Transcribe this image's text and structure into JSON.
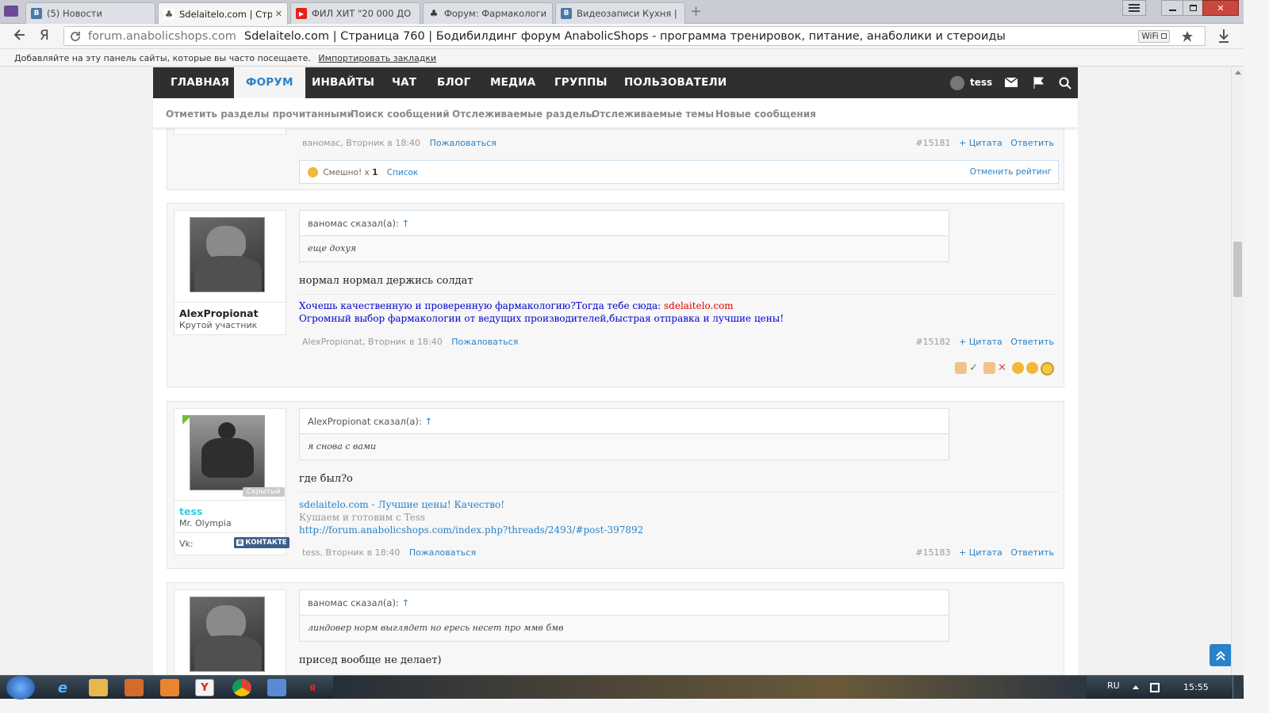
{
  "browser": {
    "tabs": [
      {
        "label": "(5) Новости",
        "icon": "vk-icon",
        "color": "#4a76a8",
        "glyph": "В"
      },
      {
        "label": "Sdelaitelo.com | Стран",
        "icon": "forum-favicon-icon",
        "color": "#555555",
        "glyph": "♣"
      },
      {
        "label": "ФИЛ ХИТ \"20 000 ДО",
        "icon": "youtube-icon",
        "color": "#e62117",
        "glyph": "▶"
      },
      {
        "label": "Форум: Фармакологи",
        "icon": "forum-favicon-icon",
        "color": "#555555",
        "glyph": "♣"
      },
      {
        "label": "Видеозаписи Кухня |",
        "icon": "vk-icon",
        "color": "#4a76a8",
        "glyph": "В"
      }
    ],
    "close_glyph": "✕",
    "new_tab_glyph": "+",
    "yandex_glyph": "Я",
    "url_domain": "forum.anabolicshops.com",
    "url_title": "Sdelaitelo.com | Страница 760 | Бодибилдинг форум AnabolicShops - программа тренировок, питание, анаболики и стероиды",
    "wifi_badge": "WiFi",
    "bookmarks_text": "Добавляйте на эту панель сайты, которые вы часто посещаете.",
    "bookmarks_link": "Импортировать закладки"
  },
  "nav": {
    "items": [
      "ГЛАВНАЯ",
      "ФОРУМ",
      "ИНВАЙТЫ",
      "ЧАТ",
      "БЛОГ",
      "МЕДИА",
      "ГРУППЫ",
      "ПОЛЬЗОВАТЕЛИ"
    ],
    "active": "ФОРУМ",
    "user": "tess"
  },
  "subnav": [
    "Отметить разделы прочитанными",
    "Поиск сообщений",
    "Отслеживаемые разделы",
    "Отслеживаемые темы",
    "Новые сообщения"
  ],
  "post0": {
    "meta": "ваномас, Вторник в 18:40",
    "report": "Пожаловаться",
    "number": "#15181",
    "quote_btn": "+ Цитата",
    "reply_btn": "Ответить",
    "rating_label": "Смешно! x",
    "rating_count": "1",
    "rating_list": "Список",
    "rating_cancel": "Отменить рейтинг"
  },
  "post1": {
    "user": "AlexPropionat",
    "title": "Крутой участник",
    "quote_author": "ваномас сказал(а):",
    "quote_arrow": "↑",
    "quote_text": "еще дохуя",
    "message": "нормал нормал держись солдат",
    "sig_line1": "Хочешь качественную и проверенную фармакологию?Тогда тебе сюда:",
    "sig_link": "sdelaitelo.com",
    "sig_line2": "Огромный выбор фармакологии от ведущих производителей,быстрая отправка и лучшие цены!",
    "meta": "AlexPropionat, Вторник в 18:40",
    "report": "Пожаловаться",
    "number": "#15182",
    "quote_btn": "+ Цитата",
    "reply_btn": "Ответить"
  },
  "post2": {
    "user": "tess",
    "title": "Mr. Olympia",
    "hidden_badge": "Скрытый",
    "vk_label": "Vk:",
    "vk_button": "КОНТАКТЕ",
    "quote_author": "AlexPropionat сказал(а):",
    "quote_arrow": "↑",
    "quote_text": "я снова с вами",
    "message": "где был?о",
    "sig_line1": "sdelaitelo.com - Лучшие цены! Качество!",
    "sig_line2": "Кушаем и готовим с Tess",
    "sig_line3": "http://forum.anabolicshops.com/index.php?threads/2493/#post-397892",
    "meta": "tess, Вторник в 18:40",
    "report": "Пожаловаться",
    "number": "#15183",
    "quote_btn": "+ Цитата",
    "reply_btn": "Ответить"
  },
  "post3": {
    "quote_author": "ваномас сказал(а):",
    "quote_arrow": "↑",
    "quote_text": "линдовер норм выглядет но ересь несет про ммв бмв",
    "message": "присед вообще не делает)"
  },
  "taskbar": {
    "lang": "RU",
    "time": "15:55"
  }
}
